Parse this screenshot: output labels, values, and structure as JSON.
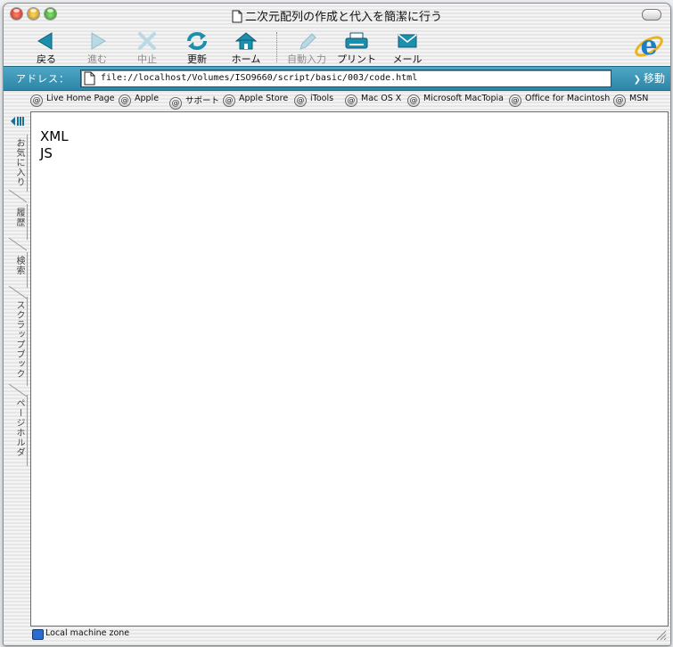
{
  "window": {
    "title": "二次元配列の作成と代入を簡潔に行う"
  },
  "toolbar": {
    "buttons": [
      {
        "label": "戻る",
        "icon": "back-arrow-icon",
        "enabled": true
      },
      {
        "label": "進む",
        "icon": "forward-arrow-icon",
        "enabled": false
      },
      {
        "label": "中止",
        "icon": "stop-x-icon",
        "enabled": false
      },
      {
        "label": "更新",
        "icon": "refresh-icon",
        "enabled": true
      },
      {
        "label": "ホーム",
        "icon": "home-icon",
        "enabled": true
      },
      {
        "label": "自動入力",
        "icon": "autofill-pen-icon",
        "enabled": false
      },
      {
        "label": "プリント",
        "icon": "printer-icon",
        "enabled": true
      },
      {
        "label": "メール",
        "icon": "mail-icon",
        "enabled": true
      }
    ],
    "logo": "internet-explorer-logo"
  },
  "address": {
    "label": "アドレス：",
    "url": "file://localhost/Volumes/ISO9660/script/basic/003/code.html",
    "go_label": "移動"
  },
  "favorites": [
    "Live Home Page",
    "Apple",
    "サポート",
    "Apple Store",
    "iTools",
    "Mac OS X",
    "Microsoft MacTopia",
    "Office for Macintosh",
    "MSN"
  ],
  "explorer_tabs": [
    "お気に入り",
    "履歴",
    "検索",
    "スクラップブック",
    "ページホルダ"
  ],
  "content": {
    "lines": [
      "XML",
      "JS"
    ]
  },
  "status": {
    "zone": "Local machine zone"
  },
  "colors": {
    "accent": "#2d86a8",
    "icon_teal": "#1c8fae"
  }
}
